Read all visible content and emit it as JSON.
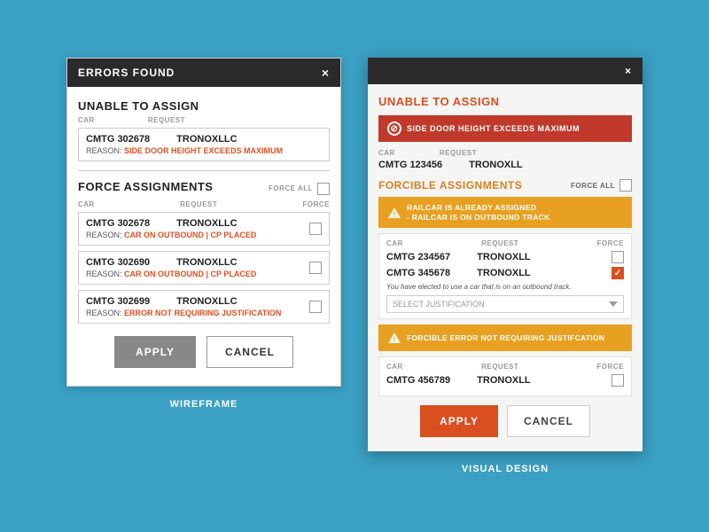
{
  "background_color": "#3aa0c4",
  "wireframe": {
    "header": "ERRORS FOUND",
    "close": "×",
    "label": "WIREFRAME",
    "unable_to_assign": {
      "title": "UNABLE TO ASSIGN",
      "col_car": "CAR",
      "col_request": "REQUEST",
      "entries": [
        {
          "car": "CMTG 302678",
          "request": "TRONOXLLC",
          "reason_prefix": "REASON:",
          "reason": "SIDE DOOR HEIGHT EXCEEDS MAXIMUM"
        }
      ]
    },
    "force_assignments": {
      "title": "FORCE ASSIGNMENTS",
      "force_all_label": "FORCE ALL",
      "col_car": "CAR",
      "col_request": "REQUEST",
      "col_force": "FORCE",
      "entries": [
        {
          "car": "CMTG 302678",
          "request": "TRONOXLLC",
          "reason_prefix": "REASON:",
          "reason": "CAR ON OUTBOUND | CP PLACED"
        },
        {
          "car": "CMTG 302690",
          "request": "TRONOXLLC",
          "reason_prefix": "REASON:",
          "reason": "CAR ON OUTBOUND | CP PLACED"
        },
        {
          "car": "CMTG 302699",
          "request": "TRONOXLLC",
          "reason_prefix": "REASON:",
          "reason": "ERROR NOT REQUIRING JUSTIFICATION"
        }
      ]
    },
    "buttons": {
      "apply": "APPLY",
      "cancel": "CANCEL"
    }
  },
  "visual": {
    "header": "×",
    "label": "VISUAL DESIGN",
    "close": "×",
    "unable_to_assign": {
      "title": "UNABLE TO ASSIGN",
      "error_banner": "SIDE DOOR HEIGHT EXCEEDS MAXIMUM",
      "col_car": "CAR",
      "col_request": "REQUEST",
      "entries": [
        {
          "car": "CMTG 123456",
          "request": "TRONOXLL"
        }
      ]
    },
    "forcible_assignments": {
      "title": "FORCIBLE ASSIGNMENTS",
      "force_all_label": "FORCE ALL",
      "warning_line1": "RAILCAR IS ALREADY ASSIGNED",
      "warning_line2": "- RAILCAR IS ON OUTBOUND TRACK",
      "col_car": "CAR",
      "col_request": "REQUEST",
      "col_force": "FORCE",
      "entries": [
        {
          "car": "CMTG 234567",
          "request": "TRONOXLL",
          "checked": false
        },
        {
          "car": "CMTG 345678",
          "request": "TRONOXLL",
          "checked": true
        }
      ],
      "justification_note": "You have elected to use a car that is on an outbound track.",
      "select_placeholder": "SELECT JUSTIFICATION",
      "forcible_error_banner": "FORCIBLE ERROR NOT REQUIRING JUSTIFCATION",
      "error_entry": {
        "car": "CMTG 456789",
        "request": "TRONOXLL",
        "checked": false
      }
    },
    "buttons": {
      "apply": "APPLY",
      "cancel": "CANCEL"
    }
  }
}
